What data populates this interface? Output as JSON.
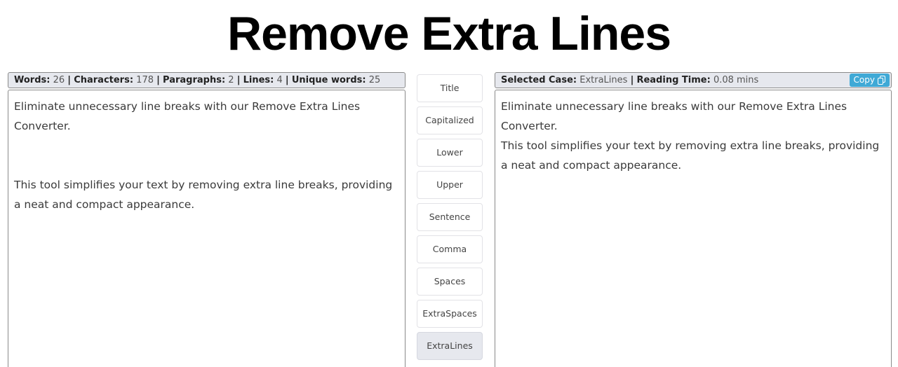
{
  "page": {
    "title": "Remove Extra Lines"
  },
  "input_stats": {
    "words_label": "Words:",
    "words": "26",
    "characters_label": "Characters:",
    "characters": "178",
    "paragraphs_label": "Paragraphs:",
    "paragraphs": "2",
    "lines_label": "Lines:",
    "lines": "4",
    "unique_label": "Unique words:",
    "unique": "25",
    "separator": "|"
  },
  "input": {
    "text": "Eliminate unnecessary line breaks with our Remove Extra Lines\nConverter.\n\n\nThis tool simplifies your text by removing extra line breaks, providing\na neat and compact appearance."
  },
  "case_buttons": [
    {
      "label": "Title",
      "active": false
    },
    {
      "label": "Capitalized",
      "active": false
    },
    {
      "label": "Lower",
      "active": false
    },
    {
      "label": "Upper",
      "active": false
    },
    {
      "label": "Sentence",
      "active": false
    },
    {
      "label": "Comma",
      "active": false
    },
    {
      "label": "Spaces",
      "active": false
    },
    {
      "label": "ExtraSpaces",
      "active": false
    },
    {
      "label": "ExtraLines",
      "active": true
    }
  ],
  "output_stats": {
    "selected_case_label": "Selected Case:",
    "selected_case": "ExtraLines",
    "reading_time_label": "Reading Time:",
    "reading_time": "0.08 mins",
    "separator": "|",
    "copy_label": "Copy",
    "copy_icon": "copy-icon"
  },
  "output": {
    "text": "Eliminate unnecessary line breaks with our Remove Extra Lines\nConverter.\nThis tool simplifies your text by removing extra line breaks, providing\na neat and compact appearance."
  },
  "colors": {
    "header_bg": "#e6e8ee",
    "copy_button": "#3fa9d6",
    "active_case": "#e6e8ee"
  }
}
